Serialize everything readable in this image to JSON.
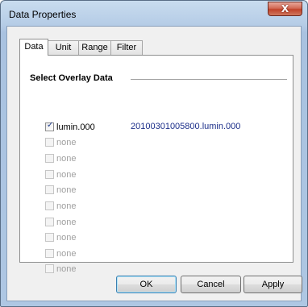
{
  "window": {
    "title": "Data Properties",
    "close_label": "X"
  },
  "tabs": [
    {
      "label": "Data",
      "active": true
    },
    {
      "label": "Unit",
      "active": false
    },
    {
      "label": "Range",
      "active": false
    },
    {
      "label": "Filter",
      "active": false
    }
  ],
  "overlay": {
    "section_title": "Select Overlay Data",
    "items": [
      {
        "label": "lumin.000",
        "checked": true,
        "enabled": true
      },
      {
        "label": "none",
        "checked": false,
        "enabled": false
      },
      {
        "label": "none",
        "checked": false,
        "enabled": false
      },
      {
        "label": "none",
        "checked": false,
        "enabled": false
      },
      {
        "label": "none",
        "checked": false,
        "enabled": false
      },
      {
        "label": "none",
        "checked": false,
        "enabled": false
      },
      {
        "label": "none",
        "checked": false,
        "enabled": false
      },
      {
        "label": "none",
        "checked": false,
        "enabled": false
      },
      {
        "label": "none",
        "checked": false,
        "enabled": false
      },
      {
        "label": "none",
        "checked": false,
        "enabled": false
      }
    ],
    "file_name": "20100301005800.lumin.000"
  },
  "buttons": {
    "ok": "OK",
    "cancel": "Cancel",
    "apply": "Apply"
  }
}
